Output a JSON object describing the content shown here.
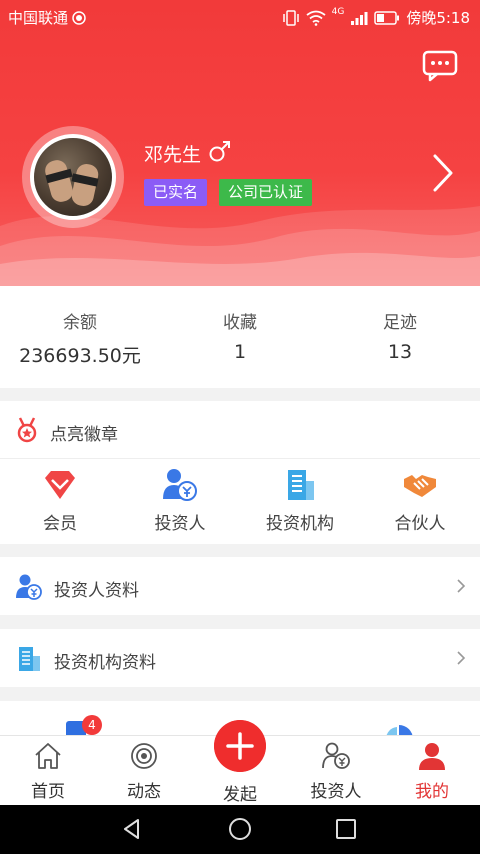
{
  "status_bar": {
    "carrier": "中国联通",
    "network": "4G",
    "time_text": "傍晚5:18"
  },
  "profile": {
    "name": "邓先生",
    "tags": [
      "已实名",
      "公司已认证"
    ]
  },
  "stats": [
    {
      "label": "余额",
      "value": "236693.50元"
    },
    {
      "label": "收藏",
      "value": "1"
    },
    {
      "label": "足迹",
      "value": "13"
    }
  ],
  "badges_section": {
    "title": "点亮徽章",
    "items": [
      {
        "label": "会员",
        "icon": "diamond-icon",
        "color": "#f04545"
      },
      {
        "label": "投资人",
        "icon": "investor-icon",
        "color": "#3a78e6"
      },
      {
        "label": "投资机构",
        "icon": "building-icon",
        "color": "#3aa7e6"
      },
      {
        "label": "合伙人",
        "icon": "handshake-icon",
        "color": "#f0883a"
      }
    ]
  },
  "list_rows": [
    {
      "label": "投资人资料",
      "icon": "investor-icon"
    },
    {
      "label": "投资机构资料",
      "icon": "building-icon"
    }
  ],
  "peek_row": {
    "badge_count": "4"
  },
  "tabbar": {
    "tabs": [
      {
        "label": "首页",
        "icon": "home-icon"
      },
      {
        "label": "动态",
        "icon": "broadcast-icon"
      },
      {
        "label": "发起",
        "icon": "plus-icon"
      },
      {
        "label": "投资人",
        "icon": "investor-icon"
      },
      {
        "label": "我的",
        "icon": "user-icon"
      }
    ],
    "active_index": 4
  },
  "colors": {
    "primary": "#f23a3a",
    "tag_real": "#8b5cf6",
    "tag_company": "#3db94a"
  }
}
